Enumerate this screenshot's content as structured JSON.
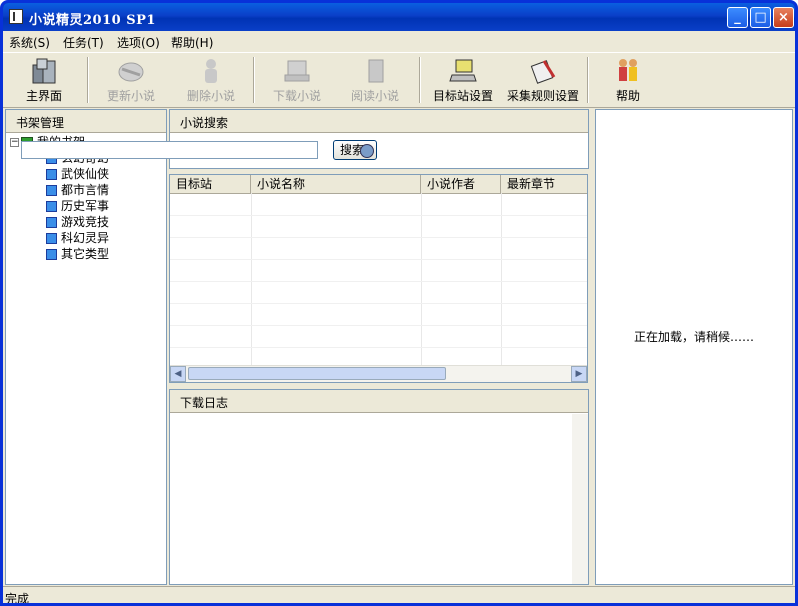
{
  "window": {
    "title": "小说精灵2010  SP1"
  },
  "menu": [
    {
      "label": "系统(S)"
    },
    {
      "label": "任务(T)"
    },
    {
      "label": "选项(O)"
    },
    {
      "label": "帮助(H)"
    }
  ],
  "toolbar": {
    "home": "主界面",
    "update": "更新小说",
    "delete": "删除小说",
    "download": "下载小说",
    "read": "阅读小说",
    "target_settings": "目标站设置",
    "rule_settings": "采集规则设置",
    "help": "帮助"
  },
  "bookshelf": {
    "title": "书架管理",
    "root": "我的书架",
    "categories": [
      "玄幻奇幻",
      "武侠仙侠",
      "都市言情",
      "历史军事",
      "游戏竞技",
      "科幻灵异",
      "其它类型"
    ]
  },
  "search": {
    "title": "小说搜索",
    "value": "",
    "button": "搜索"
  },
  "results": {
    "columns": [
      "目标站",
      "小说名称",
      "小说作者",
      "最新章节"
    ]
  },
  "log": {
    "title": "下载日志"
  },
  "right_panel": {
    "loading": "正在加载，请稍候……"
  },
  "status": {
    "text": "完成"
  }
}
